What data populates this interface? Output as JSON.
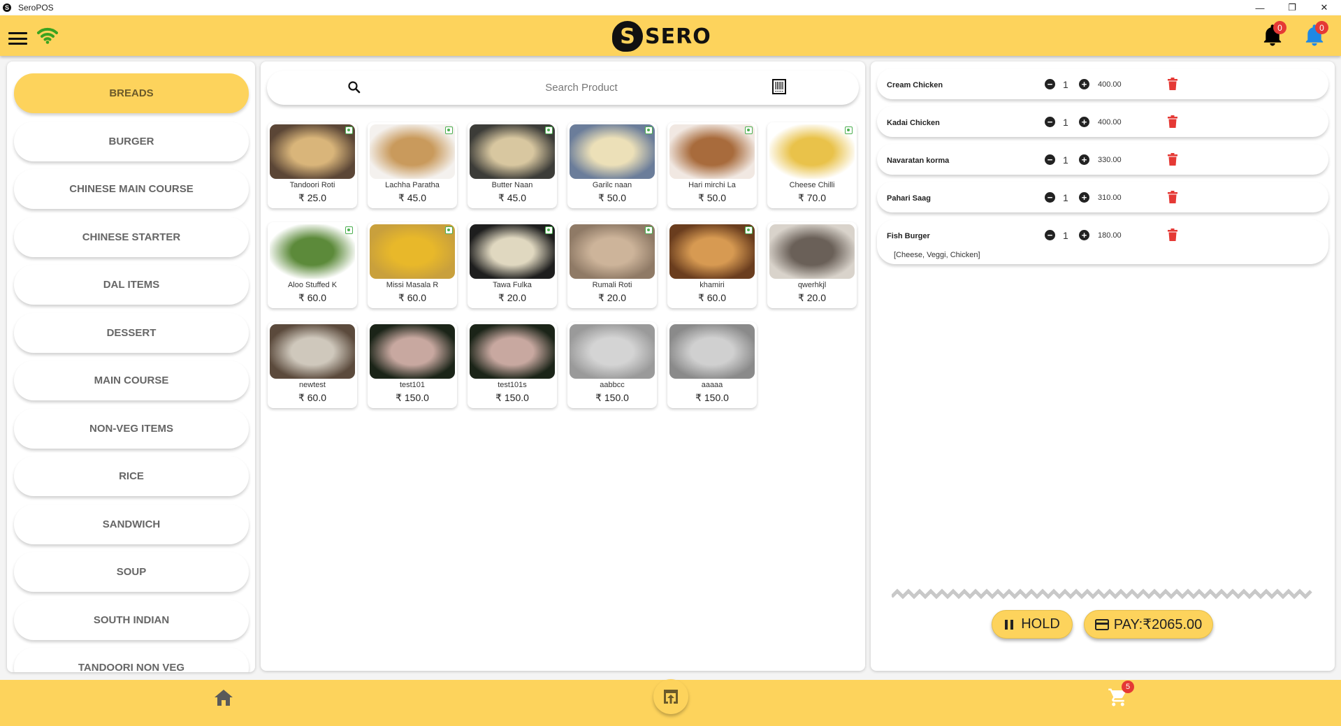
{
  "window": {
    "title": "SeroPOS",
    "minimize": "—",
    "restore": "❐",
    "close": "✕",
    "app_icon": "S"
  },
  "header": {
    "menu_icon": "hamburger-icon",
    "wifi_icon": "wifi-icon",
    "logo_mark": "S",
    "logo_text": "SERO",
    "notifications": [
      {
        "icon": "bell-icon",
        "color": "#000000",
        "count": "0"
      },
      {
        "icon": "bell-icon",
        "color": "#1E88E5",
        "count": "0"
      }
    ]
  },
  "colors": {
    "accent": "#FDD35C",
    "danger": "#E53935",
    "veg": "#4CAF50"
  },
  "categories": [
    {
      "label": "BREADS",
      "active": true
    },
    {
      "label": "BURGER"
    },
    {
      "label": "CHINESE MAIN COURSE"
    },
    {
      "label": "CHINESE STARTER"
    },
    {
      "label": "DAL ITEMS"
    },
    {
      "label": "DESSERT"
    },
    {
      "label": "MAIN COURSE"
    },
    {
      "label": "NON-VEG ITEMS"
    },
    {
      "label": "RICE"
    },
    {
      "label": "SANDWICH"
    },
    {
      "label": "SOUP"
    },
    {
      "label": "SOUTH INDIAN"
    },
    {
      "label": "TANDOORI NON VEG"
    }
  ],
  "search": {
    "placeholder": "Search Product",
    "value": ""
  },
  "products": [
    {
      "name": "Tandoori Roti",
      "price": "₹ 25.0",
      "veg": true,
      "img": [
        "#5b4636",
        "#d9b57a"
      ]
    },
    {
      "name": "Lachha Paratha",
      "price": "₹ 45.0",
      "veg": true,
      "img": [
        "#f4f1ee",
        "#c99a5c"
      ]
    },
    {
      "name": "Butter Naan",
      "price": "₹ 45.0",
      "veg": true,
      "img": [
        "#3c3c38",
        "#d8c7a0"
      ]
    },
    {
      "name": "Garilc naan",
      "price": "₹ 50.0",
      "veg": true,
      "img": [
        "#6b7d9a",
        "#ece0b8"
      ]
    },
    {
      "name": "Hari mirchi La",
      "price": "₹ 50.0",
      "veg": true,
      "img": [
        "#f1e8e2",
        "#a86b3c"
      ]
    },
    {
      "name": "Cheese Chilli",
      "price": "₹ 70.0",
      "veg": true,
      "img": [
        "#ffffff",
        "#e9c24a"
      ]
    },
    {
      "name": "Aloo Stuffed K",
      "price": "₹ 60.0",
      "veg": true,
      "img": [
        "#ffffff",
        "#5c8a3a"
      ]
    },
    {
      "name": "Missi Masala R",
      "price": "₹ 60.0",
      "veg": true,
      "img": [
        "#c9a03c",
        "#e8b82a"
      ]
    },
    {
      "name": "Tawa Fulka",
      "price": "₹ 20.0",
      "veg": true,
      "img": [
        "#1e1e1e",
        "#e0d8c0"
      ]
    },
    {
      "name": "Rumali Roti",
      "price": "₹ 20.0",
      "veg": true,
      "img": [
        "#8f7a66",
        "#cdb49a"
      ]
    },
    {
      "name": "khamiri",
      "price": "₹ 60.0",
      "veg": true,
      "img": [
        "#6a3d1e",
        "#d79a52"
      ]
    },
    {
      "name": "qwerhkjl",
      "price": "₹ 20.0",
      "veg": false,
      "img": [
        "#d9d3cb",
        "#6a6058"
      ]
    },
    {
      "name": "newtest",
      "price": "₹ 60.0",
      "veg": false,
      "img": [
        "#5b4a3c",
        "#cfc8bc"
      ]
    },
    {
      "name": "test101",
      "price": "₹ 150.0",
      "veg": false,
      "img": [
        "#1b2418",
        "#c8a8a0"
      ]
    },
    {
      "name": "test101s",
      "price": "₹ 150.0",
      "veg": false,
      "img": [
        "#1b2418",
        "#c8a8a0"
      ]
    },
    {
      "name": "aabbcc",
      "price": "₹ 150.0",
      "veg": false,
      "img": [
        "#9a9a9a",
        "#d4d4d4"
      ]
    },
    {
      "name": "aaaaa",
      "price": "₹ 150.0",
      "veg": false,
      "img": [
        "#8a8a8a",
        "#d0d0d0"
      ]
    }
  ],
  "cart": {
    "items": [
      {
        "name": "Cream Chicken",
        "qty": "1",
        "amount": "400.00"
      },
      {
        "name": "Kadai Chicken",
        "qty": "1",
        "amount": "400.00"
      },
      {
        "name": "Navaratan korma",
        "qty": "1",
        "amount": "330.00"
      },
      {
        "name": "Pahari Saag",
        "qty": "1",
        "amount": "310.00"
      },
      {
        "name": "Fish Burger",
        "qty": "1",
        "amount": "180.00",
        "modifiers": "[Cheese, Veggi, Chicken]"
      }
    ],
    "minus": "−",
    "plus": "+",
    "hold_label": "HOLD",
    "pay_label": "PAY:₹2065.00"
  },
  "bottom_nav": {
    "home_icon": "home-icon",
    "center_icon": "open-in-browser-icon",
    "cart_icon": "cart-icon",
    "cart_count": "5"
  }
}
